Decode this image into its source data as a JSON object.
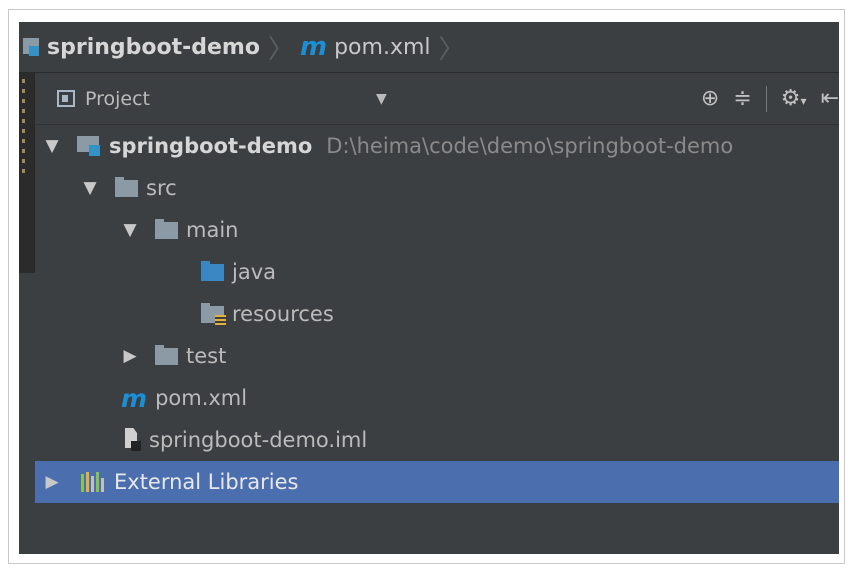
{
  "breadcrumb": {
    "project": "springboot-demo",
    "file_icon": "m",
    "file": "pom.xml"
  },
  "toolbar": {
    "view_label": "Project",
    "dropdown_glyph": "▼",
    "icons": [
      "locate-icon",
      "collapse-all-icon",
      "gear-icon",
      "hide-icon"
    ]
  },
  "tree": {
    "root": {
      "label": "springboot-demo",
      "path": "D:\\heima\\code\\demo\\springboot-demo",
      "expanded": true
    },
    "src": {
      "label": "src"
    },
    "main": {
      "label": "main"
    },
    "java": {
      "label": "java"
    },
    "resources": {
      "label": "resources"
    },
    "test": {
      "label": "test"
    },
    "pom": {
      "icon": "m",
      "label": "pom.xml"
    },
    "iml": {
      "label": "springboot-demo.iml"
    },
    "libs": {
      "label": "External Libraries",
      "selected": true
    }
  },
  "colors": {
    "background": "#3c3f41",
    "selection": "#4b6eaf",
    "maven_icon": "#1a8fd6",
    "source_folder": "#3a87c4"
  }
}
